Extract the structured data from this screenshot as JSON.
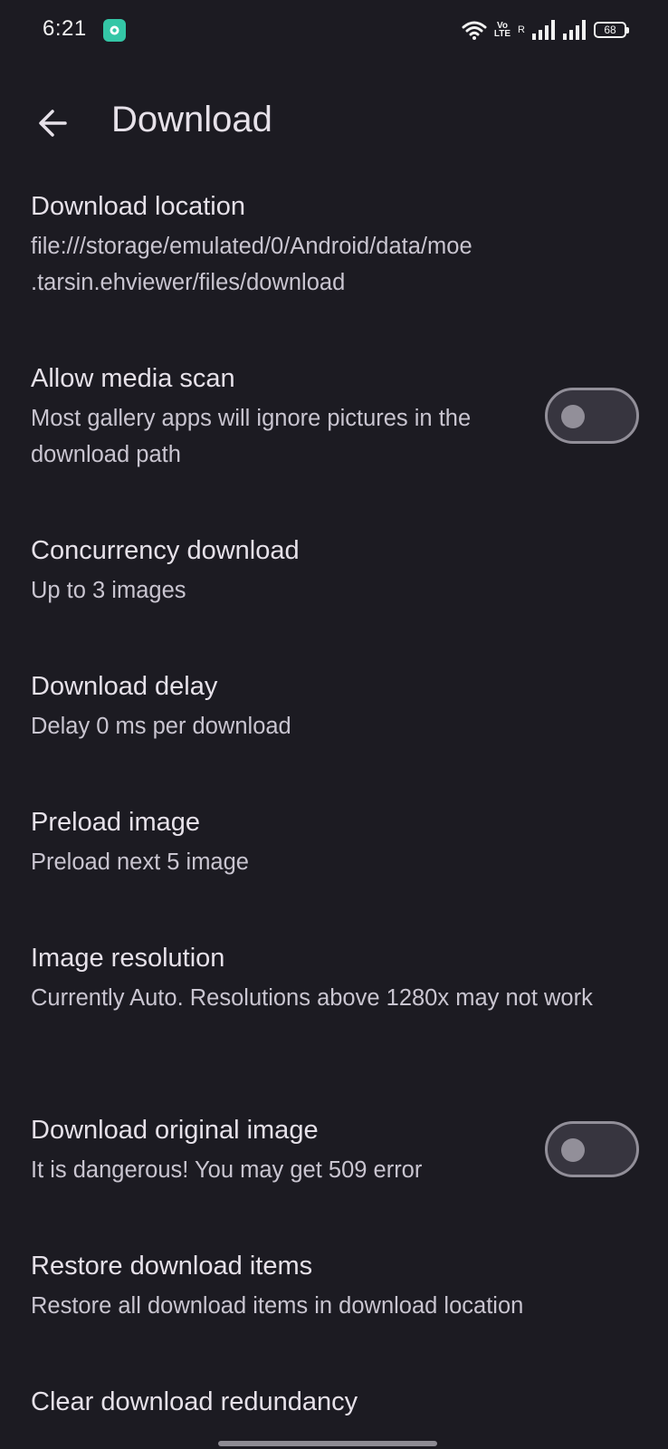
{
  "status_bar": {
    "time": "6:21",
    "volte_top": "Vo",
    "volte_bottom": "LTE",
    "roaming": "R",
    "battery": "68"
  },
  "app_bar": {
    "title": "Download",
    "back_icon": "arrow-left-icon"
  },
  "settings": {
    "items": [
      {
        "title": "Download location",
        "summary": "file:///storage/emulated/0/Android/data/moe\n.tarsin.ehviewer/files/download"
      },
      {
        "title": "Allow media scan",
        "summary": "Most gallery apps will ignore pictures in the download path",
        "switch_on": false
      },
      {
        "title": "Concurrency download",
        "summary": "Up to 3 images"
      },
      {
        "title": "Download delay",
        "summary": "Delay 0 ms per download"
      },
      {
        "title": "Preload image",
        "summary": "Preload next 5 image"
      },
      {
        "title": "Image resolution",
        "summary": "Currently Auto. Resolutions above 1280x may not work"
      },
      {
        "title": "Download original image",
        "summary": "It is dangerous! You may get 509 error",
        "switch_on": false
      },
      {
        "title": "Restore download items",
        "summary": "Restore all download items in download location"
      },
      {
        "title": "Clear download redundancy"
      }
    ]
  },
  "colors": {
    "background": "#1c1b22",
    "text_primary": "#e6e1e9",
    "text_secondary": "#c9c5d0",
    "switch_outline": "#928f99",
    "switch_track": "#37353f"
  }
}
